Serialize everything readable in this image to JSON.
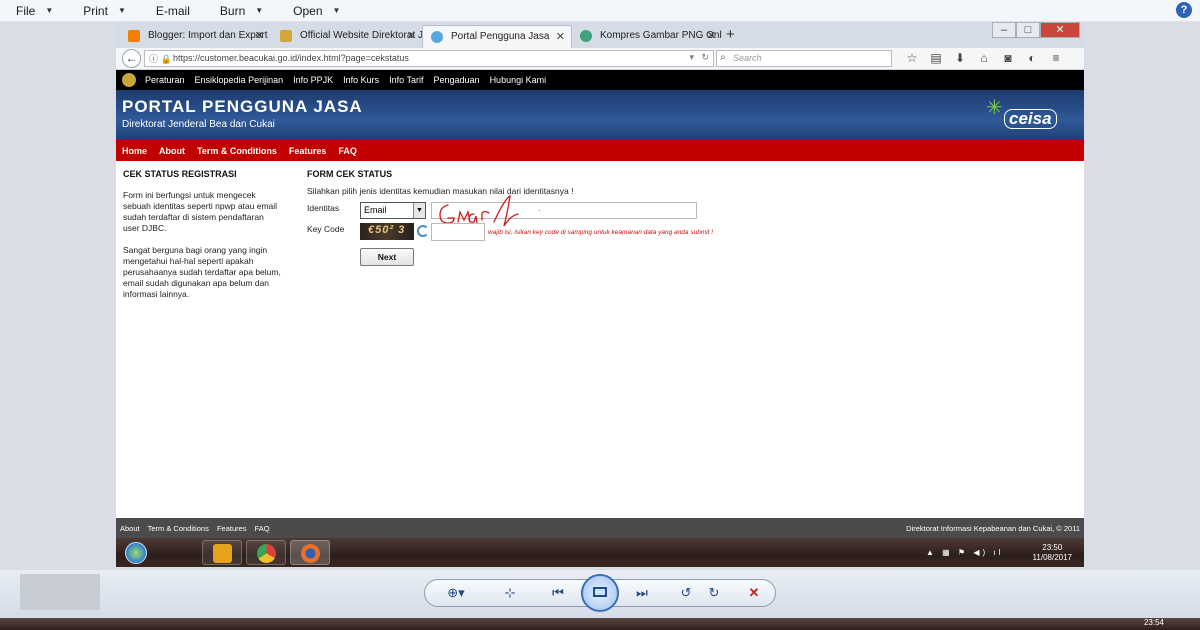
{
  "viewer": {
    "menu": [
      {
        "label": "File",
        "has_dropdown": true
      },
      {
        "label": "Print",
        "has_dropdown": true
      },
      {
        "label": "E-mail",
        "has_dropdown": false
      },
      {
        "label": "Burn",
        "has_dropdown": true
      },
      {
        "label": "Open",
        "has_dropdown": true
      }
    ],
    "help_glyph": "?"
  },
  "browser": {
    "tabs": [
      {
        "title": "Blogger: Import dan Export C",
        "icon_color": "#f57d00",
        "active": false
      },
      {
        "title": "Official Website Direktorat Je",
        "icon_color": "#d4a63a",
        "active": false
      },
      {
        "title": "Portal Pengguna Jasa",
        "icon_color": "#58a7e0",
        "active": true
      },
      {
        "title": "Kompres Gambar PNG Onlin",
        "icon_color": "#3fa27a",
        "active": false
      }
    ],
    "url": "https://customer.beacukai.go.id/index.html?page=cekstatus",
    "search_placeholder": "Search",
    "window_controls": {
      "minimize": "–",
      "maximize": "□",
      "close": "✕"
    }
  },
  "site": {
    "top_links": [
      "Peraturan",
      "Ensiklopedia Perijinan",
      "Info PPJK",
      "Info Kurs",
      "Info Tarif",
      "Pengaduan",
      "Hubungi Kami"
    ],
    "banner_title": "PORTAL PENGGUNA JASA",
    "banner_subtitle": "Direktorat Jenderal Bea dan Cukai",
    "logo_text": "ceisa",
    "main_nav": [
      "Home",
      "About",
      "Term & Conditions",
      "Features",
      "FAQ"
    ],
    "left": {
      "title": "CEK STATUS REGISTRASI",
      "paragraph1": "Form ini berfungsi untuk mengecek sebuah identitas seperti npwp atau email sudah terdaftar di sistem pendaftaran user DJBC.",
      "paragraph2": "Sangat berguna bagi orang yang ingin mengetahui hal-hal seperti apakah perusahaanya sudah terdaftar apa belum, email sudah digunakan apa belum dan informasi lainnya."
    },
    "form": {
      "title": "FORM CEK STATUS",
      "instruction": "Silahkan pilih jenis identitas kemudian masukan nilai dari identitasnya !",
      "identity_label": "Identitas",
      "identity_selected": "Email",
      "identity_value": "·",
      "keycode_label": "Key Code",
      "captcha_text": "€50² 3",
      "keycode_hint": "wajib isi, isikan key code di samping untuk keamanan data yang anda submit !",
      "next_label": "Next"
    },
    "footer_links": [
      "About",
      "Term & Conditions",
      "Features",
      "FAQ"
    ],
    "footer_copyright": "Direktorat Informasi Kepabeanan dan Cukai, © 2011"
  },
  "taskbar": {
    "time": "23:50",
    "date": "11/08/2017",
    "apps": [
      {
        "name": "internet-explorer",
        "color": "#2f7fd1"
      },
      {
        "name": "outlook",
        "color": "#e6a21a"
      },
      {
        "name": "chrome",
        "color": "#d9433a"
      },
      {
        "name": "firefox",
        "color": "#e8702a"
      }
    ]
  },
  "viewer_bottom": {
    "time": "23:54"
  }
}
